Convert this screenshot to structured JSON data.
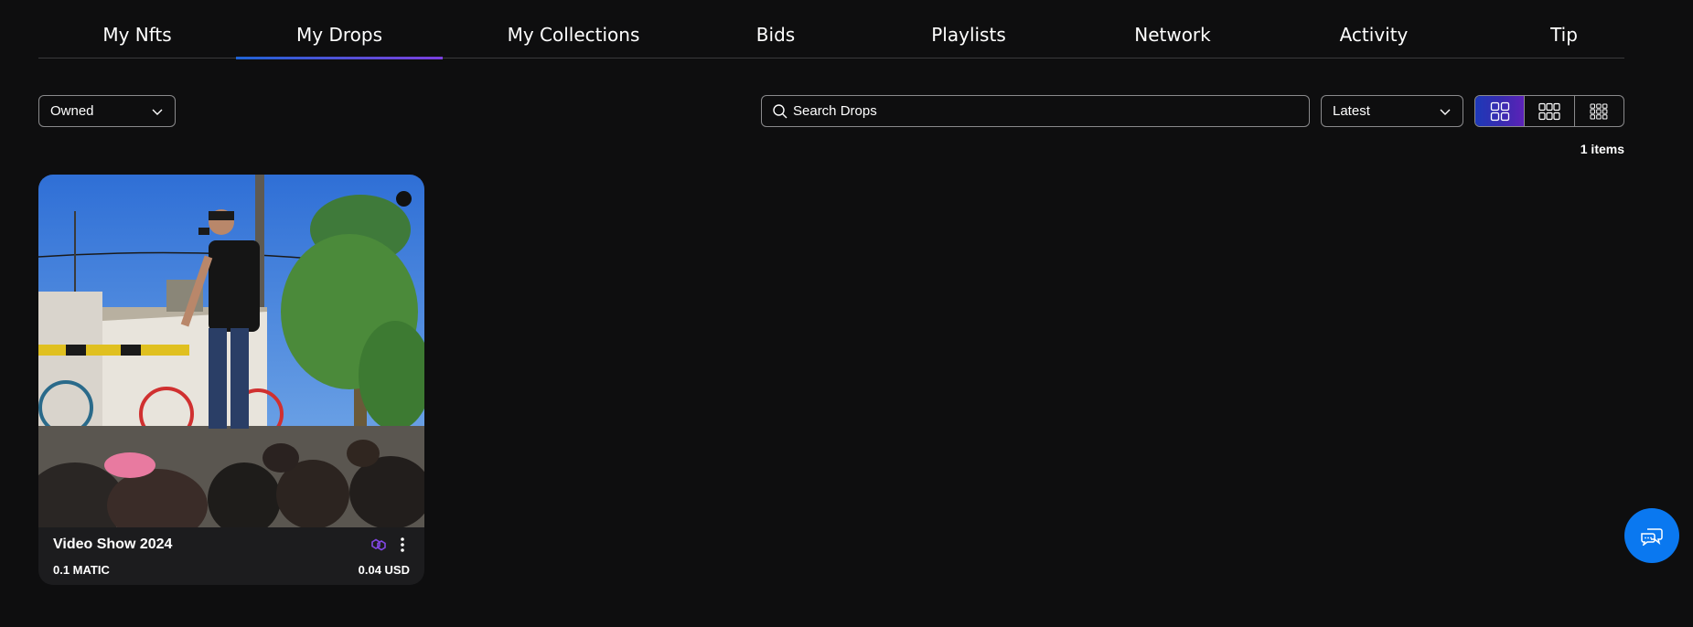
{
  "tabs": [
    {
      "label": "My Nfts",
      "active": false
    },
    {
      "label": "My Drops",
      "active": true
    },
    {
      "label": "My Collections",
      "active": false
    },
    {
      "label": "Bids",
      "active": false
    },
    {
      "label": "Playlists",
      "active": false
    },
    {
      "label": "Network",
      "active": false
    },
    {
      "label": "Activity",
      "active": false
    },
    {
      "label": "Tip",
      "active": false
    }
  ],
  "filters": {
    "ownership": "Owned",
    "search_placeholder": "Search Drops",
    "search_value": "",
    "sort": "Latest",
    "view_modes": [
      "large-grid-icon",
      "medium-grid-icon",
      "small-grid-icon"
    ],
    "active_view": "large-grid-icon"
  },
  "item_count": "1 items",
  "cards": [
    {
      "title": "Video Show 2024",
      "price": "0.1 MATIC",
      "usd": "0.04 USD",
      "chain_icon": "polygon-icon"
    }
  ],
  "colors": {
    "background": "#0e0e0f",
    "card": "#1c1c1e",
    "accent_start": "#1d39b8",
    "accent_end": "#5c22b8",
    "chat_button": "#0a78f0",
    "polygon": "#8247e5"
  },
  "chat_button_icon": "chat-icon"
}
